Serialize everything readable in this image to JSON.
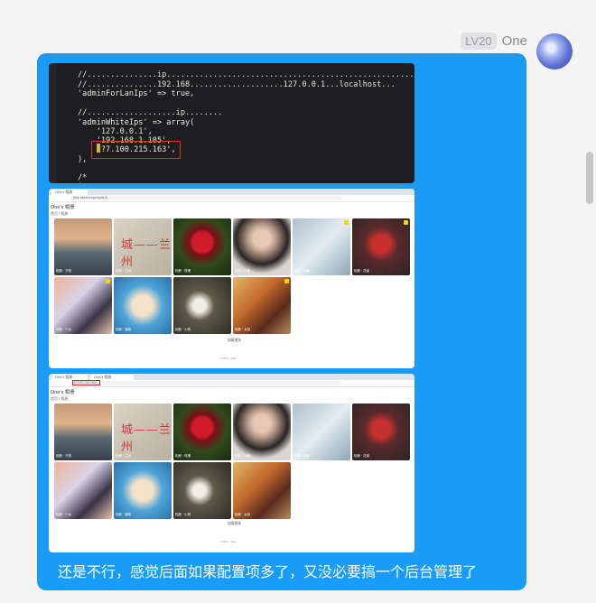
{
  "header": {
    "level": "LV20",
    "name": "One"
  },
  "code": {
    "lines": [
      "//...............ip.......................................................",
      "//...............192.168....................127.0.0.1...localhost...",
      "'adminForLanIps' => true,",
      "",
      "//...................ip........",
      "'adminWhiteIps' => array(",
      "    '127.0.0.1',",
      "    '192.168.1.105',",
      "    '?7.100.215.163',",
      "),",
      "",
      "/*",
      "*"
    ]
  },
  "shot1": {
    "tab": "One's 相册",
    "url": "jfthe.hsinfra.top/mp/ai.ts",
    "title": "One's 相册",
    "nav": "首页 / 相册",
    "tiles": [
      "相册 · 夕阳",
      "相册 · 兰州",
      "相册 · 玫瑰",
      "相册 · 人像",
      "相册 · 插画",
      "相册 · 花束",
      "相册 · 少女",
      "相册 · 猫咪",
      "相册 · 小狗",
      "相册 · 女孩"
    ],
    "load_more": "加载更多",
    "footer": "©2023 · Wiki"
  },
  "shot2": {
    "tab1": "One's 相册",
    "tab2": "One's 相册",
    "url": "47.100.215.163/...",
    "title": "One's 相册",
    "nav": "首页 / 相册",
    "tiles": [
      "相册 · 夕阳",
      "相册 · 兰州",
      "相册 · 玫瑰",
      "相册 · 人像",
      "相册 · 插画",
      "相册 · 花束",
      "相册 · 少女",
      "相册 · 猫咪",
      "相册 · 小狗",
      "相册 · 女孩"
    ],
    "load_more": "加载更多",
    "footer": "©2023 · Wiki"
  },
  "tile1_text": "城——兰州",
  "message": "还是不行，感觉后面如果配置项多了，又没必要搞一个后台管理了",
  "colors": {
    "bubble": "#1a9bf5",
    "highlight": "#d8342c"
  }
}
